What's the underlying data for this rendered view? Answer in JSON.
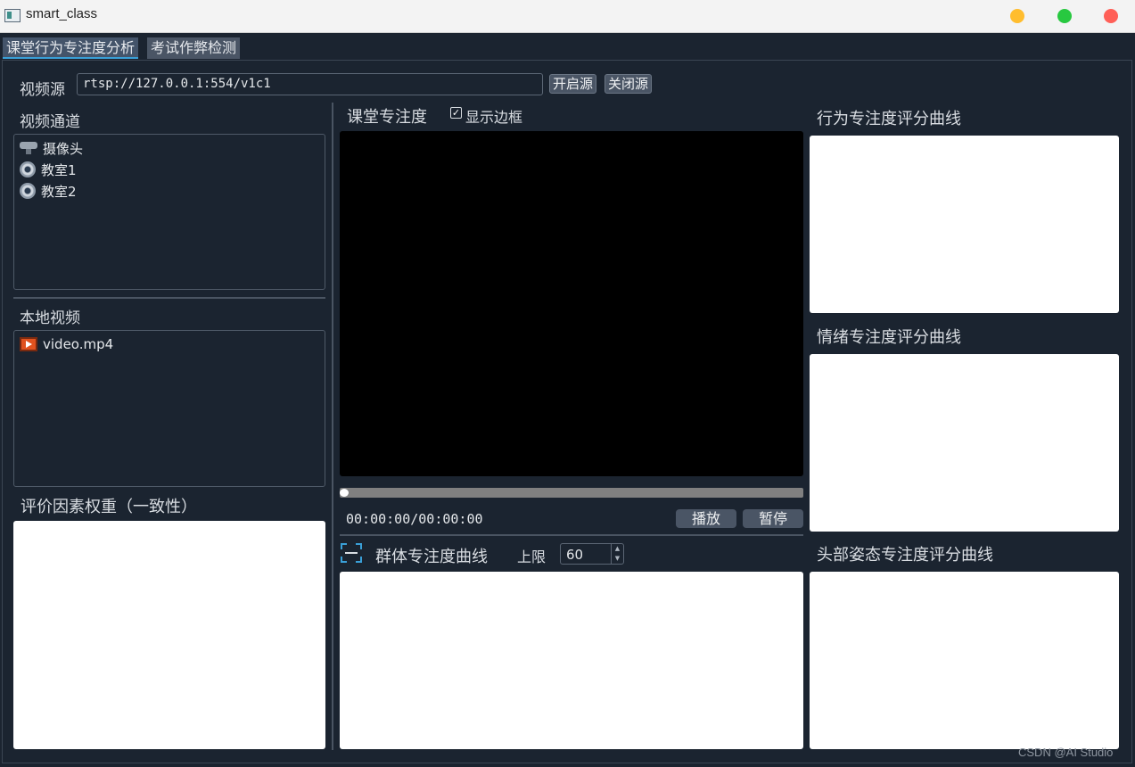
{
  "window": {
    "title": "smart_class"
  },
  "tabs": [
    {
      "label": "课堂行为专注度分析",
      "active": true
    },
    {
      "label": "考试作弊检测",
      "active": false
    }
  ],
  "source": {
    "label": "视频源",
    "url": "rtsp://127.0.0.1:554/v1c1",
    "open_label": "开启源",
    "close_label": "关闭源"
  },
  "channels": {
    "title": "视频通道",
    "items": [
      {
        "label": "摄像头",
        "icon": "webcam-icon"
      },
      {
        "label": "教室1",
        "icon": "camera-icon"
      },
      {
        "label": "教室2",
        "icon": "camera-icon"
      }
    ]
  },
  "local_videos": {
    "title": "本地视频",
    "items": [
      {
        "label": "video.mp4",
        "icon": "video-file-icon"
      }
    ]
  },
  "weights": {
    "title": "评价因素权重（一致性）"
  },
  "player": {
    "title": "课堂专注度",
    "show_box_label": "显示边框",
    "show_box_checked": true,
    "progress": 0.0,
    "time": "00:00:00/00:00:00",
    "play_label": "播放",
    "pause_label": "暂停"
  },
  "group_curve": {
    "title": "群体专注度曲线",
    "limit_label": "上限",
    "limit_value": "60"
  },
  "right_panels": {
    "behavior_title": "行为专注度评分曲线",
    "emotion_title": "情绪专注度评分曲线",
    "head_title": "头部姿态专注度评分曲线"
  },
  "watermark": "CSDN @AI Studio",
  "colors": {
    "background": "#1b2430",
    "button": "#4a5565",
    "accent": "#3aa0d8"
  }
}
